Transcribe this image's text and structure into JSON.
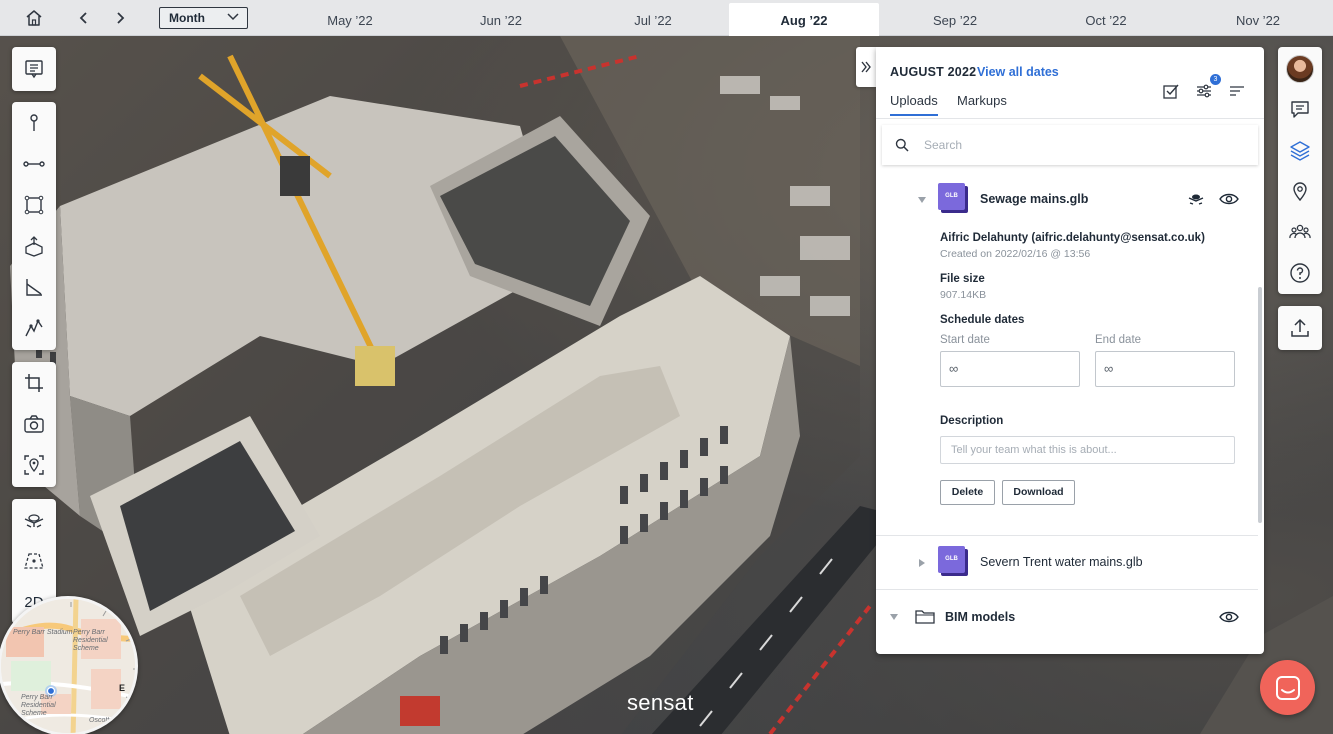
{
  "topbar": {
    "granularity": "Month",
    "months": [
      "May ’22",
      "Jun ’22",
      "Jul ’22",
      "Aug ’22",
      "Sep ’22",
      "Oct ’22",
      "Nov ’22"
    ],
    "active_month": "Aug ’22"
  },
  "left_toolbar": {
    "view_2d_label": "2D"
  },
  "minimap": {
    "labels": [
      "Perry Barr Stadium",
      "Perry Barr Residential Scheme",
      "Perry Barr Residential Scheme",
      "Oscott Road",
      "E"
    ]
  },
  "panel": {
    "date_heading": "AUGUST 2022",
    "view_all_link": "View all dates",
    "tabs": [
      "Uploads",
      "Markups"
    ],
    "active_tab": "Uploads",
    "filter_count": "3",
    "search_placeholder": "Search",
    "files": [
      {
        "name": "Sewage mains.glb",
        "badge": "GLB",
        "expanded": true,
        "uploader": "Aifric Delahunty (aifric.delahunty@sensat.co.uk)",
        "created": "Created on 2022/02/16 @ 13:56",
        "file_size_label": "File size",
        "file_size": "907.14KB",
        "schedule_label": "Schedule dates",
        "start_label": "Start date",
        "start_value": "∞",
        "end_label": "End date",
        "end_value": "∞",
        "description_label": "Description",
        "description_placeholder": "Tell your team what this is about...",
        "delete_label": "Delete",
        "download_label": "Download"
      },
      {
        "name": "Severn Trent water mains.glb",
        "badge": "GLB",
        "expanded": false
      }
    ],
    "folder": {
      "name": "BIM models"
    }
  },
  "brand": "sensat",
  "colors": {
    "accent": "#2f6fd6",
    "glb_icon": "#7b69dc",
    "chat_button": "#f0645a"
  }
}
